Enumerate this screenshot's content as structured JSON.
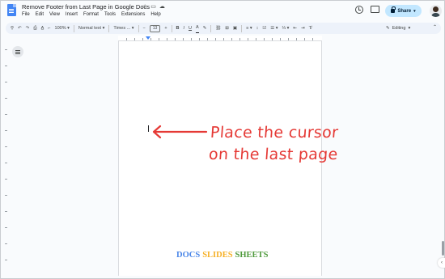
{
  "window": {
    "doc_title": "Remove Footer from Last Page in Google Docs",
    "title_icons": [
      "star-icon",
      "move-folder-icon",
      "cloud-saved-icon"
    ]
  },
  "menu": [
    "File",
    "Edit",
    "View",
    "Insert",
    "Format",
    "Tools",
    "Extensions",
    "Help"
  ],
  "header_right": {
    "share_label": "Share"
  },
  "toolbar": {
    "zoom": "100%",
    "style": "Normal text",
    "font": "Times ...",
    "minus": "−",
    "font_size": "13",
    "plus": "+",
    "bold": "B",
    "italic": "I",
    "underline": "U",
    "text_color": "A",
    "mode": "Editing"
  },
  "annotation": {
    "line1": "Place the cursor",
    "line2": "on the last page",
    "color": "#e53935"
  },
  "footer": {
    "word1": "DOCS",
    "word2": "SLIDES",
    "word3": "SHEETS",
    "color1": "#4a86e8",
    "color2": "#f6b026",
    "color3": "#4f9a3c"
  }
}
